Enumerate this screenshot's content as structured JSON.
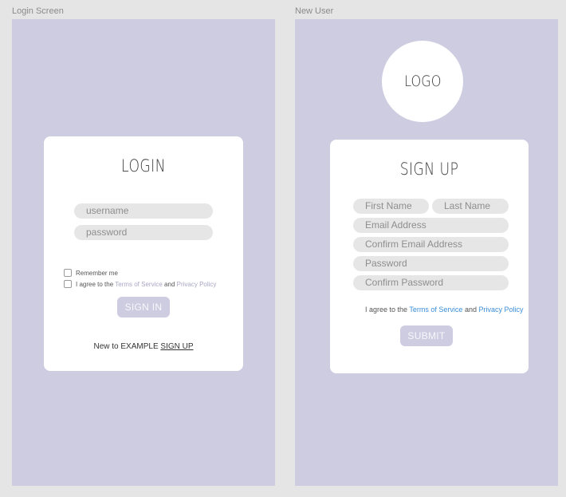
{
  "frames": {
    "login_label": "Login Screen",
    "signup_label": "New User"
  },
  "login": {
    "title": "LOGIN",
    "username_placeholder": "username",
    "password_placeholder": "password",
    "remember_label": "Remember me",
    "agree_prefix": "I agree to the",
    "terms_link": "Terms of Service",
    "agree_and": "and",
    "privacy_link": "Privacy Policy",
    "submit_label": "SIGN IN",
    "footer_prefix": "New to EXAMPLE",
    "footer_link": "SIGN UP"
  },
  "signup": {
    "logo": "LOGO",
    "title": "SIGN UP",
    "first_name": "First Name",
    "last_name": "Last Name",
    "email": "Email Address",
    "confirm_email": "Confirm Email Address",
    "password": "Password",
    "confirm_password": "Confirm Password",
    "agree_prefix": "I agree to the",
    "terms_link": "Terms of Service",
    "agree_and": "and",
    "privacy_link": "Privacy Policy",
    "submit_label": "SUBMIT"
  },
  "colors": {
    "canvas": "#e5e5e5",
    "frame_bg": "#cecce1",
    "card_bg": "#ffffff",
    "field_bg": "#e6e6e6",
    "button_bg": "#cecce1",
    "link_blue": "#3c8ed8"
  }
}
